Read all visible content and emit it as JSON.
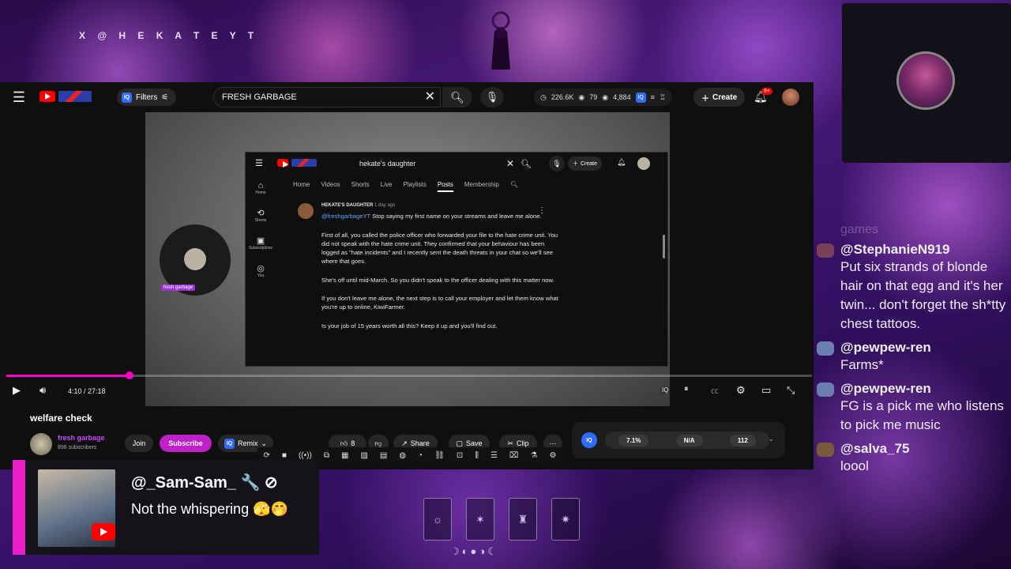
{
  "overlay": {
    "handle": "X @ H E K A T E Y T"
  },
  "browser": {
    "search_value": "FRESH GARBAGE",
    "filters_label": "Filters",
    "iq_label": "IQ",
    "stats": [
      "226.6K",
      "79",
      "4,884"
    ],
    "create_label": "Create",
    "notif_badge": "9+"
  },
  "inner_screenshot": {
    "search_value": "hekate's daughter",
    "create_label": "Create",
    "sidebar": [
      {
        "icon": "home-icon",
        "label": "Home"
      },
      {
        "icon": "shorts-icon",
        "label": "Shorts"
      },
      {
        "icon": "subscriptions-icon",
        "label": "Subscriptions"
      },
      {
        "icon": "you-icon",
        "label": "You"
      }
    ],
    "tabs": [
      "Home",
      "Videos",
      "Shorts",
      "Live",
      "Playlists",
      "Posts",
      "Membership"
    ],
    "active_tab": "Posts",
    "post": {
      "author": "HEKATE'S DAUGHTER",
      "time": "1 day ago",
      "mention": "@freshgarbageYT",
      "line1": "Stop saying my first name on your streams and leave me alone.",
      "p2": "First of all, you called the police officer who forwarded your file to the hate crime unit. You did not speak with the hate crime unit. They confirmed that your behaviour has been logged as \"hate incidents\" and I recently sent the death threats in your chat so we'll see where that goes.",
      "p3": "She's off until mid-March. So you didn't speak to the officer dealing with this matter now.",
      "p4": "If you don't leave me alone, the next step is to call your employer and let them know what you're up to online, KiwiFarmer.",
      "p5": "Is your job of 15 years worth all this? Keep it up and you'll find out."
    },
    "video_tag": "fresh garbage"
  },
  "player": {
    "time": "4:10 / 27:18",
    "progress": 0.153
  },
  "video": {
    "title": "welfare check",
    "channel": "fresh garbage",
    "subscribers": "898 subscribers",
    "join_label": "Join",
    "subscribe_label": "Subscribe",
    "remix_label": "Remix",
    "like_count": "8",
    "share_label": "Share",
    "save_label": "Save",
    "clip_label": "Clip"
  },
  "iq_panel": {
    "label": "IQ",
    "values": [
      "7.1%",
      "N/A",
      "112"
    ]
  },
  "chat_popup": {
    "user": "@_Sam-Sam_ 🔧 ⊘",
    "message": "Not the whispering 🫣🤭"
  },
  "chat": {
    "faded_text": "games",
    "messages": [
      {
        "user": "@StephanieN919",
        "text": "Put six strands of blonde hair on that egg and it's her twin... don't forget the sh*tty chest tattoos."
      },
      {
        "user": "@pewpew-ren",
        "text": "Farms*"
      },
      {
        "user": "@pewpew-ren",
        "text": "FG is a pick me who listens to pick me music"
      },
      {
        "user": "@salva_75",
        "text": "loool"
      }
    ]
  },
  "colors": {
    "accent": "#c020c8",
    "progress": "#ff00cc",
    "popup_bar": "#e91ec8"
  }
}
